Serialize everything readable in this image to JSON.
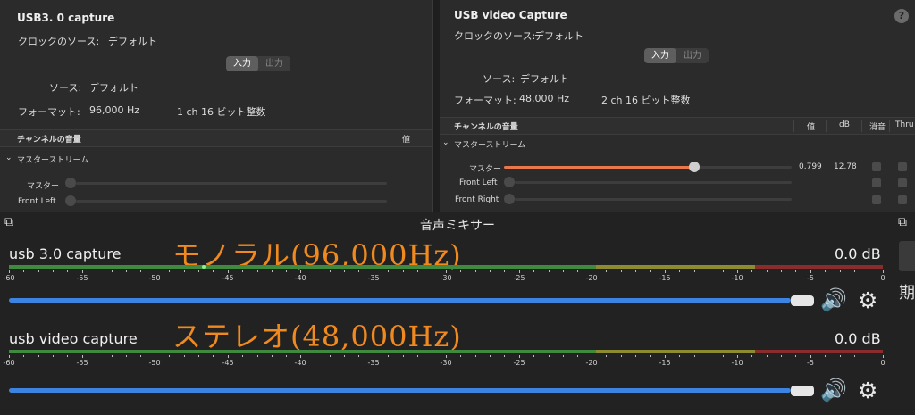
{
  "left_panel": {
    "device_title": "USB3. 0 capture",
    "clock_source_label": "クロックのソース:",
    "clock_source_value": "デフォルト",
    "tab_input": "入力",
    "tab_output": "出力",
    "source_label": "ソース:",
    "source_value": "デフォルト",
    "format_label": "フォーマット:",
    "format_rate": "96,000 Hz",
    "format_channels": "1 ch 16 ビット整数",
    "volume_header": "チャンネルの音量",
    "value_header": "値",
    "master_stream": "マスターストリーム",
    "channels": [
      {
        "label": "マスター"
      },
      {
        "label": "Front Left"
      }
    ]
  },
  "right_panel": {
    "device_title": "USB video Capture",
    "help": "?",
    "clock_source_label": "クロックのソース:",
    "clock_source_value": "デフォルト",
    "tab_input": "入力",
    "tab_output": "出力",
    "source_label": "ソース:",
    "source_value": "デフォルト",
    "format_label": "フォーマット:",
    "format_rate": "48,000 Hz",
    "format_channels": "2 ch 16 ビット整数",
    "volume_header": "チャンネルの音量",
    "headers": {
      "value": "値",
      "db": "dB",
      "mute": "消音",
      "thru": "Thru"
    },
    "master_stream": "マスターストリーム",
    "channels": [
      {
        "label": "マスター",
        "value": "0.799",
        "db": "12.78",
        "level": 0.799
      },
      {
        "label": "Front Left"
      },
      {
        "label": "Front Right"
      }
    ]
  },
  "mixer": {
    "title": "音声ミキサー",
    "tracks": [
      {
        "name": "usb 3.0 capture",
        "db": "0.0 dB",
        "annotation": "モノラル(96,000Hz)",
        "volume_level": 1.0
      },
      {
        "name": "usb video capture",
        "db": "0.0 dB",
        "annotation": "ステレオ(48,000Hz)",
        "volume_level": 1.0
      }
    ],
    "scale": [
      "-60",
      "-55",
      "-50",
      "-45",
      "-40",
      "-35",
      "-30",
      "-25",
      "-20",
      "-15",
      "-10",
      "-5",
      "0"
    ],
    "side_glyph": "期",
    "colors": {
      "meter_green": "#3f8a3f",
      "meter_yellow": "#8d8b2f",
      "meter_red": "#8a2c2c",
      "fader": "#3d84e0",
      "annotation": "#f08a1f",
      "slider_orange": "#e8784a"
    }
  }
}
